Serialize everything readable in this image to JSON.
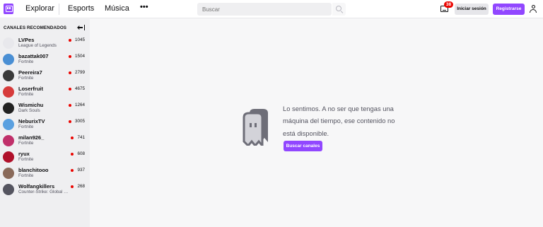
{
  "topnav": {
    "logo_icon": "twitch-logo-icon",
    "links": {
      "explorar": "Explorar",
      "esports": "Esports",
      "musica": "Música"
    },
    "more_icon": "more-dots-icon",
    "more_glyph": "•••",
    "search": {
      "placeholder": "Buscar",
      "icon": "search-icon"
    },
    "inbox": {
      "icon": "inbox-icon",
      "badge": "38"
    },
    "login_label": "Iniciar sesión",
    "register_label": "Registrarse",
    "user_icon": "user-icon"
  },
  "sidebar": {
    "title": "CANALES RECOMENDADOS",
    "collapse_icon": "collapse-arrow-icon",
    "channels": [
      {
        "name": "LVPes",
        "game": "League of Legends",
        "viewers": "1045",
        "avatar_color": "#e8e8ec"
      },
      {
        "name": "bazattak007",
        "game": "Fortnite",
        "viewers": "1504",
        "avatar_color": "#4a8fd4"
      },
      {
        "name": "Peereira7",
        "game": "Fortnite",
        "viewers": "2799",
        "avatar_color": "#3a3a3a"
      },
      {
        "name": "Loserfruit",
        "game": "Fortnite",
        "viewers": "4675",
        "avatar_color": "#d63b3b"
      },
      {
        "name": "Wismichu",
        "game": "Dark Souls",
        "viewers": "1264",
        "avatar_color": "#222222"
      },
      {
        "name": "NeburixTV",
        "game": "Fortnite",
        "viewers": "3005",
        "avatar_color": "#5aa0e0"
      },
      {
        "name": "milan926_",
        "game": "Fortnite",
        "viewers": "741",
        "avatar_color": "#c0306a"
      },
      {
        "name": "ryux",
        "game": "Fortnite",
        "viewers": "608",
        "avatar_color": "#b0102a"
      },
      {
        "name": "blanchitooo",
        "game": "Fortnite",
        "viewers": "937",
        "avatar_color": "#8a6a5a"
      },
      {
        "name": "Wolfangkillers",
        "game": "Counter-Strike: Global Offensive",
        "viewers": "268",
        "avatar_color": "#555560"
      }
    ]
  },
  "main": {
    "ghost_icon": "ghost-icon",
    "message": "Lo sentimos. A no ser que tengas una máquina del tiempo, ese contenido no está disponible.",
    "browse_label": "Buscar canales"
  },
  "colors": {
    "accent": "#9147ff",
    "live": "#eb0400",
    "sidebar_bg": "#efeff1",
    "main_bg": "#f7f7f8"
  }
}
